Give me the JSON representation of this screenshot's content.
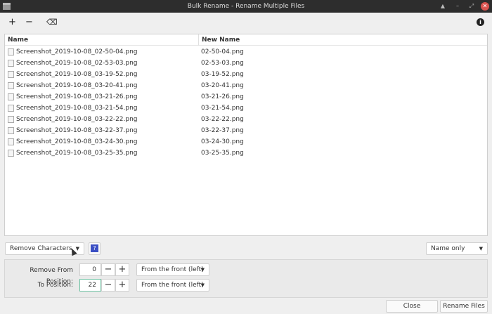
{
  "window": {
    "title": "Bulk Rename - Rename Multiple Files"
  },
  "toolbar": {
    "add": "+",
    "remove": "−",
    "clear": "⌫",
    "info": "i"
  },
  "list": {
    "headers": [
      "Name",
      "New Name"
    ],
    "rows": [
      {
        "name": "Screenshot_2019-10-08_02-50-04.png",
        "new": "02-50-04.png"
      },
      {
        "name": "Screenshot_2019-10-08_02-53-03.png",
        "new": "02-53-03.png"
      },
      {
        "name": "Screenshot_2019-10-08_03-19-52.png",
        "new": "03-19-52.png"
      },
      {
        "name": "Screenshot_2019-10-08_03-20-41.png",
        "new": "03-20-41.png"
      },
      {
        "name": "Screenshot_2019-10-08_03-21-26.png",
        "new": "03-21-26.png"
      },
      {
        "name": "Screenshot_2019-10-08_03-21-54.png",
        "new": "03-21-54.png"
      },
      {
        "name": "Screenshot_2019-10-08_03-22-22.png",
        "new": "03-22-22.png"
      },
      {
        "name": "Screenshot_2019-10-08_03-22-37.png",
        "new": "03-22-37.png"
      },
      {
        "name": "Screenshot_2019-10-08_03-24-30.png",
        "new": "03-24-30.png"
      },
      {
        "name": "Screenshot_2019-10-08_03-25-35.png",
        "new": "03-25-35.png"
      }
    ]
  },
  "options": {
    "mode": "Remove Characters",
    "help": "?",
    "scope": "Name only",
    "from_label": "Remove From Position:",
    "from_value": "0",
    "from_dir": "From the front (left)",
    "to_label": "To Position:",
    "to_value": "22",
    "to_dir": "From the front (left)"
  },
  "buttons": {
    "close": "Close",
    "rename": "Rename Files"
  }
}
